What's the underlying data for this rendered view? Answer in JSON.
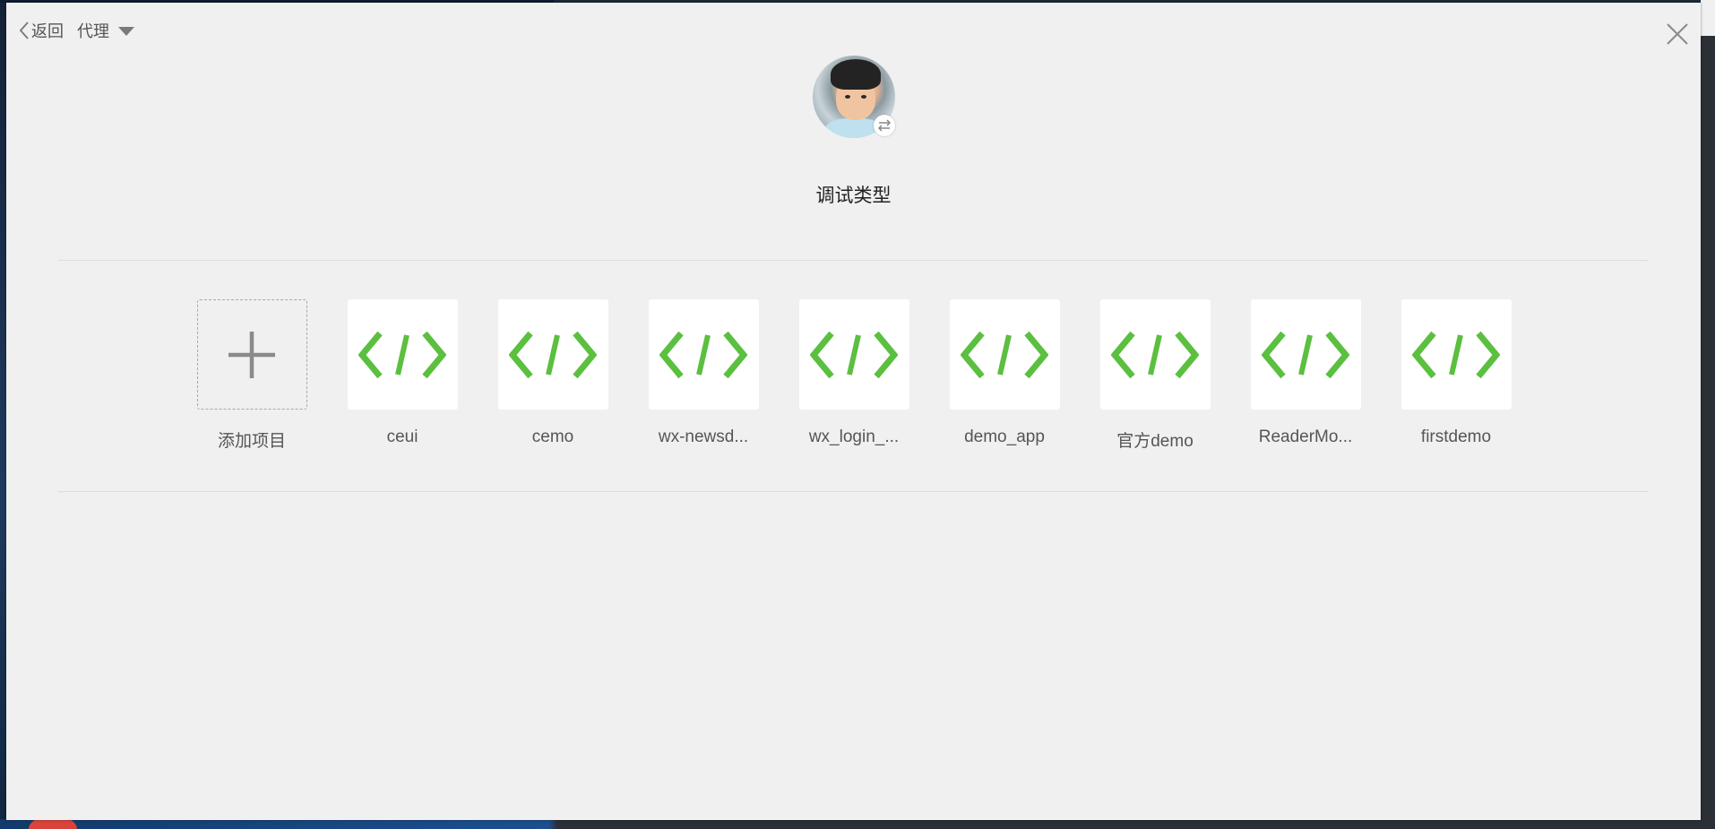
{
  "header": {
    "back_label": "返回",
    "proxy_label": "代理"
  },
  "page_title": "调试类型",
  "projects": [
    {
      "label": "添加项目",
      "icon": "plus-icon",
      "type": "add"
    },
    {
      "label": "ceui",
      "icon": "code-icon"
    },
    {
      "label": "cemo",
      "icon": "code-icon"
    },
    {
      "label": "wx-newsd...",
      "icon": "code-icon"
    },
    {
      "label": "wx_login_...",
      "icon": "code-icon"
    },
    {
      "label": "demo_app",
      "icon": "code-icon"
    },
    {
      "label": "官方demo",
      "icon": "code-icon"
    },
    {
      "label": "ReaderMo...",
      "icon": "code-icon"
    },
    {
      "label": "firstdemo",
      "icon": "code-icon"
    }
  ],
  "colors": {
    "code_icon": "#5bbf3f",
    "plus_icon": "#8a8a8a",
    "dialog_bg": "#f0f0f0"
  }
}
